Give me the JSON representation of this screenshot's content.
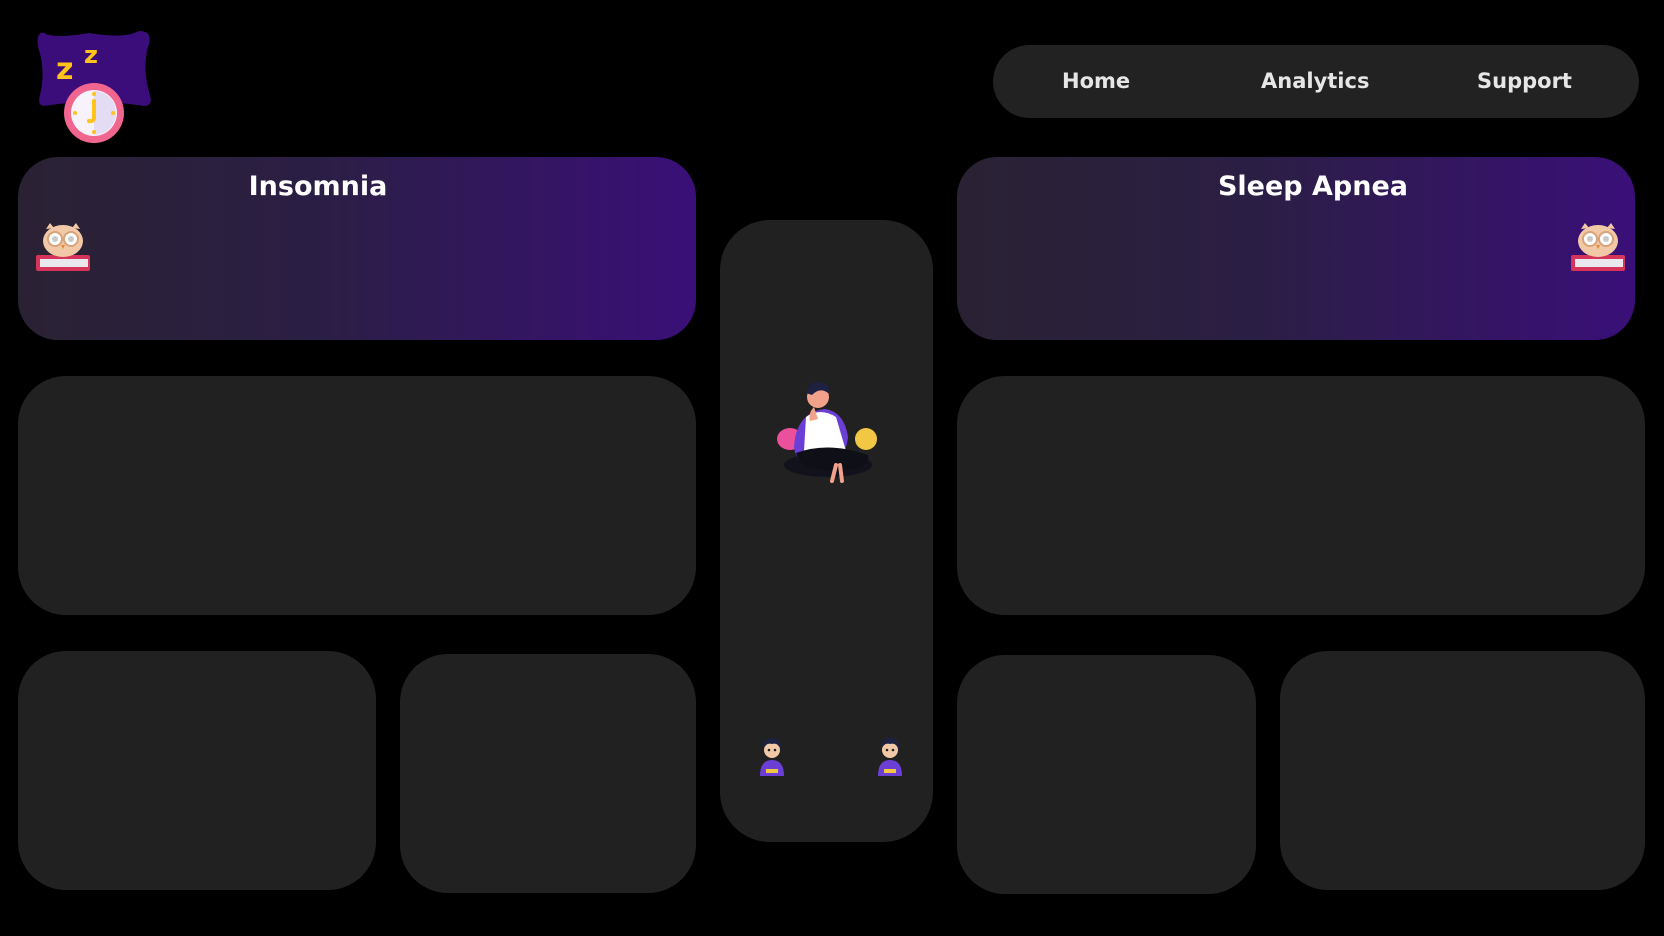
{
  "brand": {
    "logo_icon": "sleep-clock-logo-icon",
    "accent": "#3b0d7a",
    "clock_color": "#f0668f",
    "z_color": "#ffc31a"
  },
  "nav": {
    "items": [
      {
        "label": "Home"
      },
      {
        "label": "Analytics"
      },
      {
        "label": "Support"
      }
    ]
  },
  "panels": {
    "insomnia": {
      "title": "Insomnia",
      "icon": "owl-on-books-icon"
    },
    "sleep_apnea": {
      "title": "Sleep Apnea",
      "icon": "owl-on-books-icon"
    }
  },
  "center": {
    "illustration": "tired-person-sitting-illustration",
    "avatars": [
      "person-avatar-icon",
      "person-avatar-icon"
    ]
  },
  "colors": {
    "background": "#000000",
    "card": "#212121",
    "gradient_end": "#3a0f78"
  }
}
